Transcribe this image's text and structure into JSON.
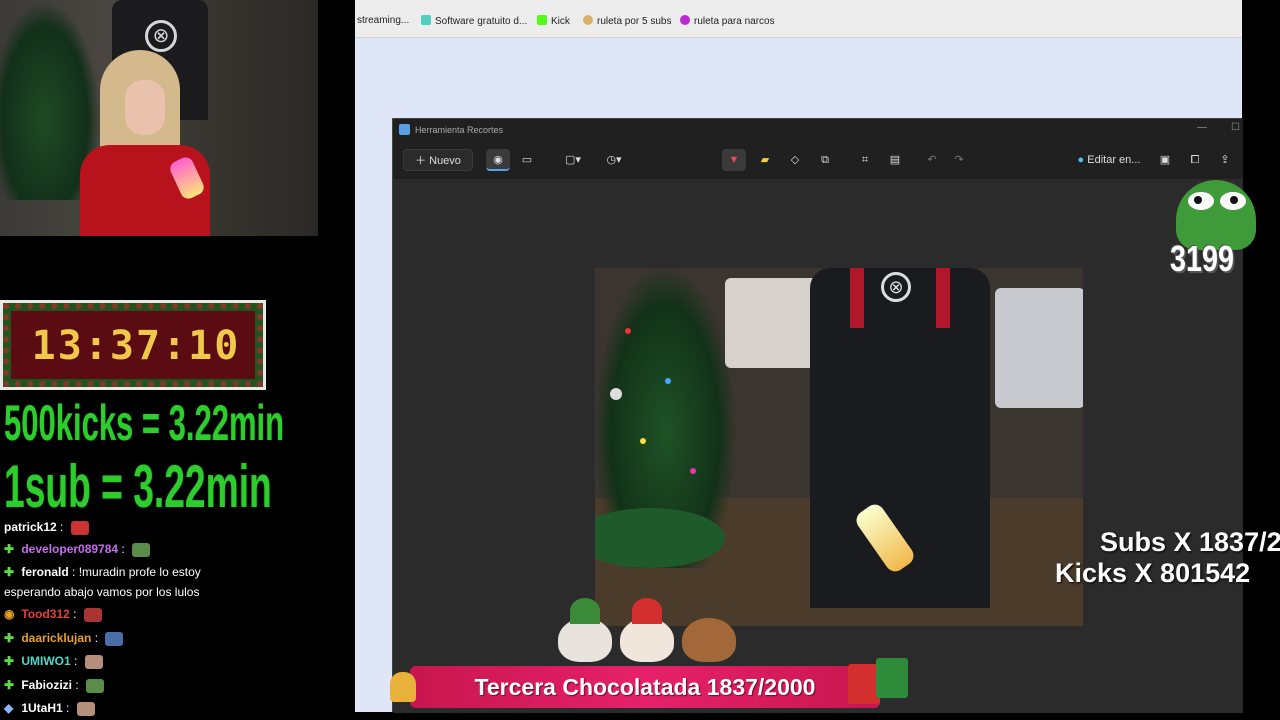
{
  "timer": {
    "display": "13:37:10"
  },
  "rates": {
    "kicks": "500kicks = 3.22min",
    "sub": "1sub = 3.22min"
  },
  "chat": [
    {
      "user": "patrick12",
      "message": ":",
      "color": "#ffffff",
      "partial": true
    },
    {
      "user": "developer089784",
      "message": ":",
      "color": "#c56cf0"
    },
    {
      "user": "feronald",
      "message": ": !muradin profe lo estoy",
      "color": "#ffffff"
    },
    {
      "user": "",
      "message": "esperando abajo vamos por los lulos",
      "color": "#ffffff"
    },
    {
      "user": "Tood312",
      "message": ":",
      "color": "#e0413a"
    },
    {
      "user": "daaricklujan",
      "message": ":",
      "color": "#e6a12a"
    },
    {
      "user": "UMIWO1",
      "message": ":",
      "color": "#4fd7c8"
    },
    {
      "user": "Fabiozizi",
      "message": ":",
      "color": "#ffffff"
    },
    {
      "user": "1UtaH1",
      "message": ":",
      "color": "#ffffff"
    }
  ],
  "browser": {
    "bookmarks": [
      {
        "label": "streaming...",
        "icon": "none",
        "color": "#00000000"
      },
      {
        "label": "Software gratuito d...",
        "icon": "software-icon",
        "color": "#4ecfc1"
      },
      {
        "label": "Kick",
        "icon": "kick-icon",
        "color": "#53fc18"
      },
      {
        "label": "ruleta por 5 subs",
        "icon": "wheel-icon",
        "color": "#d8b26a"
      },
      {
        "label": "ruleta para narcos",
        "icon": "wheel-icon",
        "color": "#c026d3"
      }
    ]
  },
  "snip": {
    "title": "Herramienta Recortes",
    "new_label": "Nuevo",
    "edit_label": "Editar en...",
    "minimize": "—",
    "maximize": "☐"
  },
  "overlay": {
    "counter": "3199",
    "subs": "Subs X 1837/2",
    "kicks": "Kicks X 801542"
  },
  "banner": {
    "text": "Tercera Chocolatada 1837/2000"
  },
  "colors": {
    "accent_green": "#2dcd2d",
    "banner_pink": "#e6216a",
    "timer_gold": "#f1c94a"
  }
}
